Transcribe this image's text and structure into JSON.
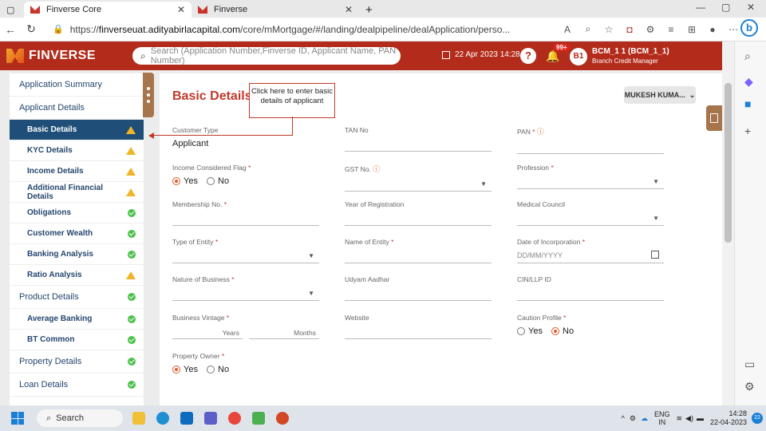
{
  "browser": {
    "tabs": [
      {
        "title": "Finverse Core",
        "active": true
      },
      {
        "title": "Finverse",
        "active": false
      }
    ],
    "url_prefix": "https://",
    "url_host": "finverseuat.adityabirlacapital.com",
    "url_path": "/core/mMortgage/#/landing/dealpipeline/dealApplication/perso..."
  },
  "header": {
    "brand": "FINVERSE",
    "search_placeholder": "Search (Application Number,Finverse ID, Applicant Name, PAN Number)",
    "date": "22 Apr 2023 14:28",
    "notif_badge": "99+",
    "avatar_initials": "B1",
    "user_name": "BCM_1 1 (BCM_1_1)",
    "user_role": "Branch Credit Manager"
  },
  "sidebar": {
    "items": [
      {
        "label": "Application Summary",
        "type": "section",
        "status": ""
      },
      {
        "label": "Applicant Details",
        "type": "section",
        "status": ""
      },
      {
        "label": "Basic Details",
        "type": "sub",
        "status": "warn",
        "active": true
      },
      {
        "label": "KYC Details",
        "type": "sub",
        "status": "warn"
      },
      {
        "label": "Income Details",
        "type": "sub",
        "status": "warn"
      },
      {
        "label": "Additional Financial Details",
        "type": "sub",
        "status": "warn"
      },
      {
        "label": "Obligations",
        "type": "sub",
        "status": "ok"
      },
      {
        "label": "Customer Wealth",
        "type": "sub",
        "status": "ok"
      },
      {
        "label": "Banking Analysis",
        "type": "sub",
        "status": "ok"
      },
      {
        "label": "Ratio Analysis",
        "type": "sub",
        "status": "warn"
      },
      {
        "label": "Product Details",
        "type": "section",
        "status": "ok"
      },
      {
        "label": "Average Banking",
        "type": "sub",
        "status": "ok"
      },
      {
        "label": "BT Common",
        "type": "sub",
        "status": "ok"
      },
      {
        "label": "Property Details",
        "type": "section",
        "status": "ok"
      },
      {
        "label": "Loan Details",
        "type": "section",
        "status": "ok"
      }
    ]
  },
  "main": {
    "title": "Basic Details",
    "callout": "Click here to enter basic details of applicant",
    "user_dropdown": "MUKESH KUMA...",
    "fields": {
      "customer_type": {
        "label": "Customer Type",
        "value": "Applicant"
      },
      "tan_no": {
        "label": "TAN No"
      },
      "pan": {
        "label": "PAN",
        "required": "*"
      },
      "income_flag": {
        "label": "Income Considered Flag",
        "required": "*",
        "opt_yes": "Yes",
        "opt_no": "No"
      },
      "gst_no": {
        "label": "GST No."
      },
      "profession": {
        "label": "Profession",
        "required": "*"
      },
      "membership_no": {
        "label": "Membership No.",
        "required": "*"
      },
      "year_registration": {
        "label": "Year of Registration"
      },
      "medical_council": {
        "label": "Medical Council"
      },
      "type_entity": {
        "label": "Type of Entity",
        "required": "*"
      },
      "name_entity": {
        "label": "Name of Entity",
        "required": "*"
      },
      "date_incorp": {
        "label": "Date of Incorporation",
        "required": "*",
        "placeholder": "DD/MM/YYYY"
      },
      "nature_business": {
        "label": "Nature of Business",
        "required": "*"
      },
      "udyam": {
        "label": "Udyam Aadhar"
      },
      "cin": {
        "label": "CIN/LLP ID"
      },
      "business_vintage": {
        "label": "Business Vintage",
        "required": "*",
        "years": "Years",
        "months": "Months"
      },
      "website": {
        "label": "Website"
      },
      "caution_profile": {
        "label": "Caution Profile",
        "required": "*",
        "opt_yes": "Yes",
        "opt_no": "No"
      },
      "property_owner": {
        "label": "Property Owner",
        "required": "*",
        "opt_yes": "Yes",
        "opt_no": "No"
      }
    }
  },
  "taskbar": {
    "search_label": "Search",
    "lang": "ENG",
    "region": "IN",
    "time": "14:28",
    "date": "22-04-2023",
    "notif_count": "22"
  },
  "colors": {
    "header_red": "#b32c1b",
    "active_nav": "#1f4f78",
    "accent_orange": "#e05a2a"
  }
}
